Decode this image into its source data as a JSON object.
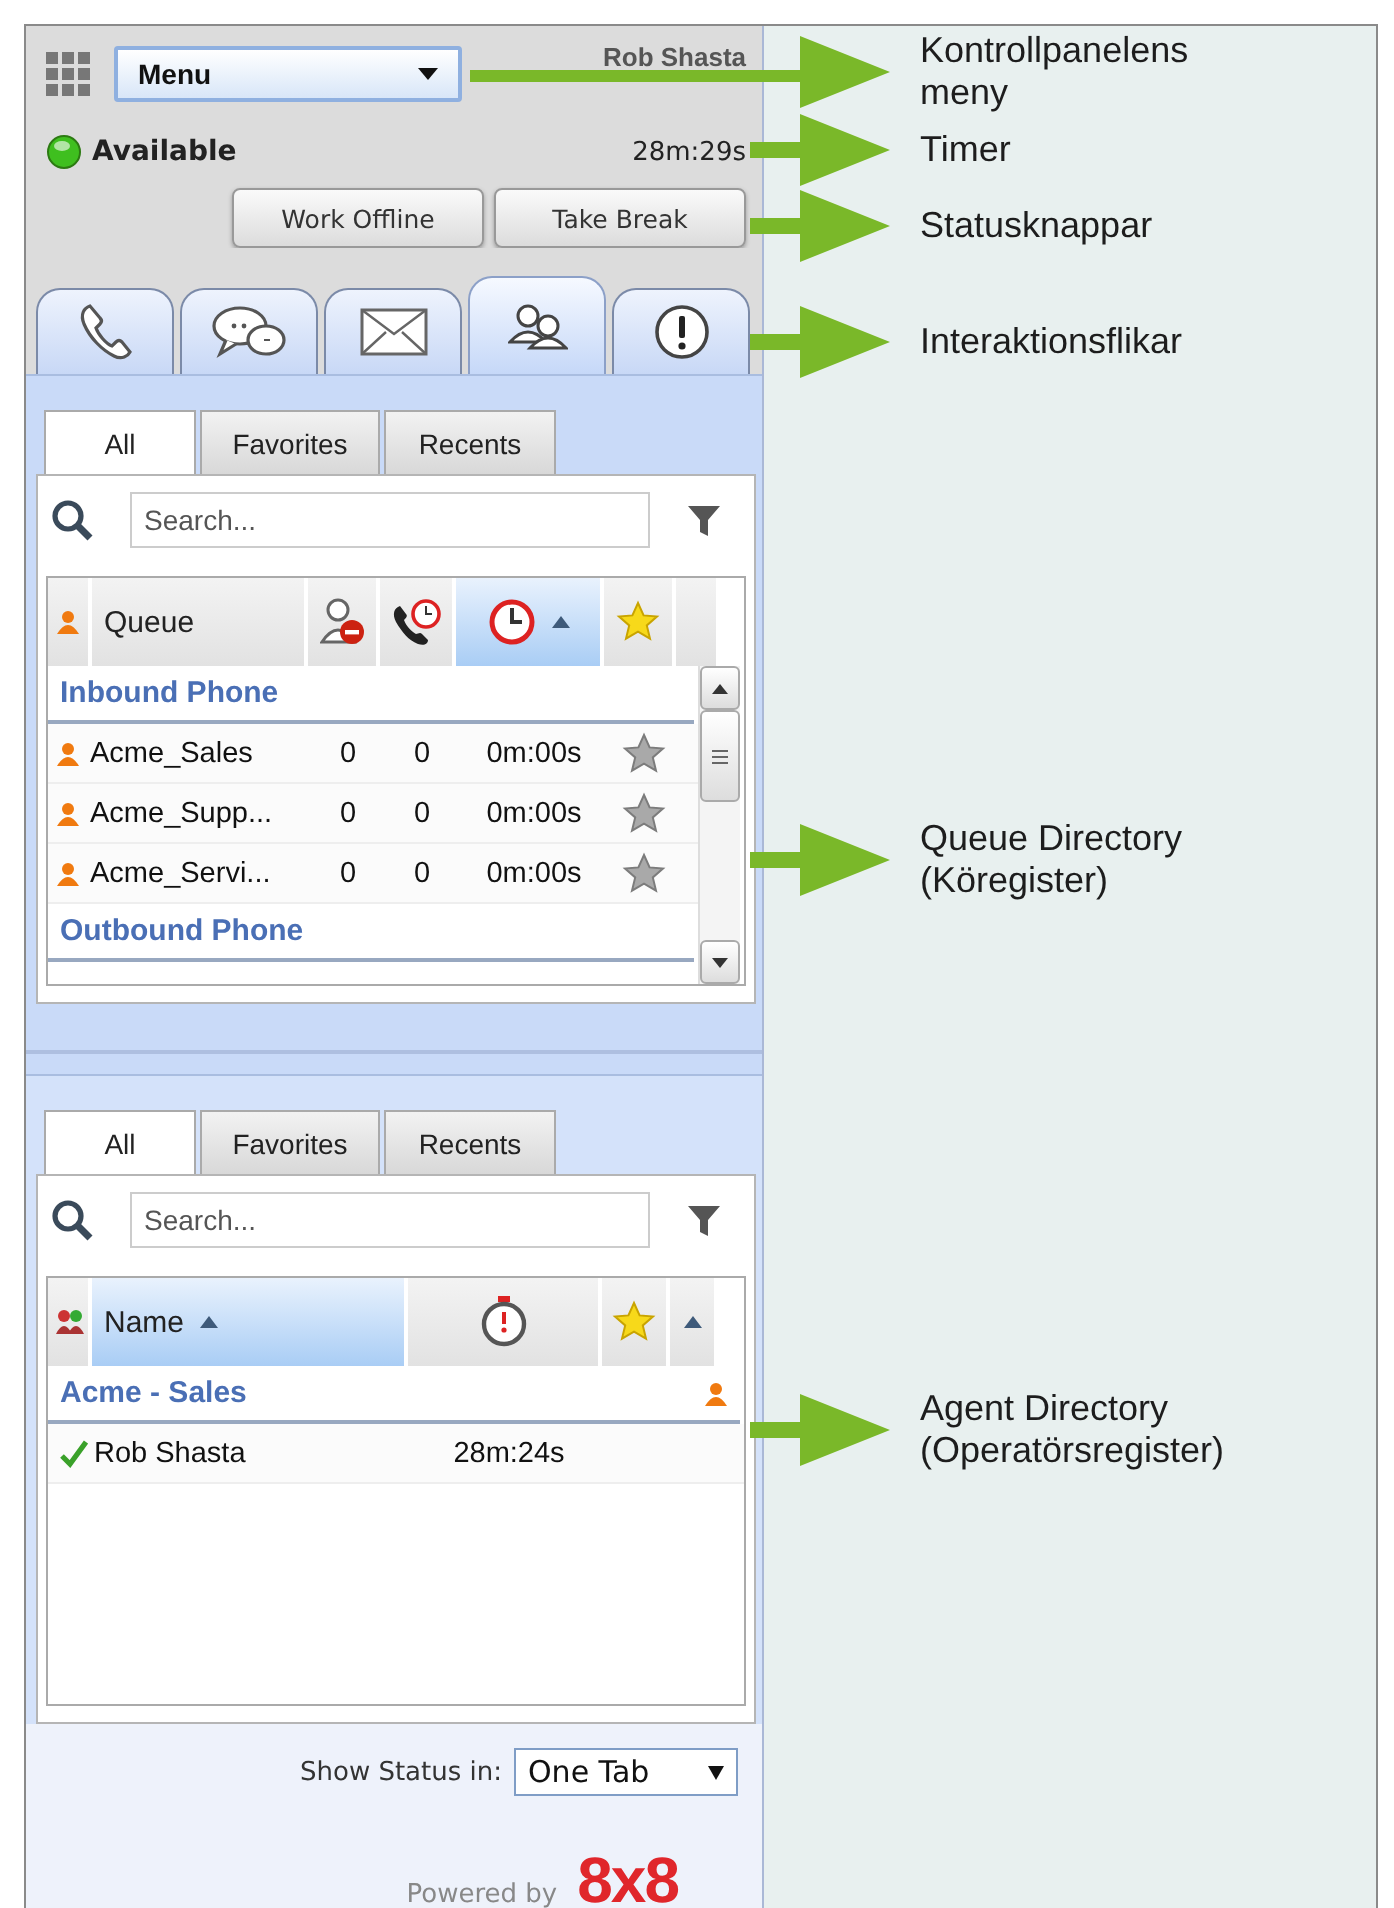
{
  "header": {
    "menu": "Menu",
    "user_name": "Rob Shasta",
    "available": true,
    "status": "Available",
    "timer": "28m:29s"
  },
  "status_buttons": [
    "Work Offline",
    "Take Break"
  ],
  "interaction_tabs": [
    {
      "kind": "phone",
      "selected": false
    },
    {
      "kind": "chat",
      "selected": false
    },
    {
      "kind": "email",
      "selected": false
    },
    {
      "kind": "directory",
      "selected": true
    },
    {
      "kind": "alert",
      "selected": false
    }
  ],
  "queue_directory": {
    "kind": "queues",
    "tabs": [
      {
        "label": "All",
        "selected": true
      },
      {
        "label": "Favorites",
        "selected": false
      },
      {
        "label": "Recents",
        "selected": false
      }
    ],
    "search": {
      "placeholder": "Search..."
    },
    "columns": [
      {
        "kind": "queue",
        "label": "Queue",
        "sorted": false
      },
      {
        "kind": "agents",
        "sorted": false
      },
      {
        "kind": "waiting",
        "sorted": false
      },
      {
        "kind": "time",
        "sorted": true
      },
      {
        "kind": "favorite",
        "sorted": false
      }
    ],
    "groups": [
      {
        "name": "Inbound Phone",
        "rows": [
          {
            "name": "Acme_Sales",
            "column_2": "0",
            "column_3": "0",
            "time": "0m:00s",
            "favorite": false
          },
          {
            "name": "Acme_Supp...",
            "column_2": "0",
            "column_3": "0",
            "time": "0m:00s",
            "favorite": false
          },
          {
            "name": "Acme_Servi...",
            "column_2": "0",
            "column_3": "0",
            "time": "0m:00s",
            "favorite": false
          }
        ]
      },
      {
        "name": "Outbound Phone"
      }
    ]
  },
  "agent_directory": {
    "kind": "agents",
    "tabs": [
      {
        "label": "All",
        "selected": true
      },
      {
        "label": "Favorites",
        "selected": false
      },
      {
        "label": "Recents",
        "selected": false
      }
    ],
    "search": {
      "placeholder": "Search..."
    },
    "columns": [
      {
        "kind": "agent",
        "label": "Name",
        "sorted": true
      },
      {
        "kind": "timer",
        "sorted": false
      },
      {
        "kind": "favorite",
        "sorted": false
      }
    ],
    "groups": [
      {
        "name": "Acme - Sales",
        "rows": [
          {
            "name": "Rob Shasta",
            "available": true,
            "time": "28m:24s"
          }
        ]
      }
    ]
  },
  "footer": {
    "show_status_label": "Show Status in:",
    "show_status_value": "One Tab",
    "powered_by": "Powered by",
    "logo": "8x8"
  },
  "annotations": [
    "Kontrollpanelens\nmeny",
    "Timer",
    "Statusknappar",
    "Interaktionsflikar",
    "Queue Directory\n(Köregister)",
    "Agent Directory\n(Operatörsregister)"
  ]
}
